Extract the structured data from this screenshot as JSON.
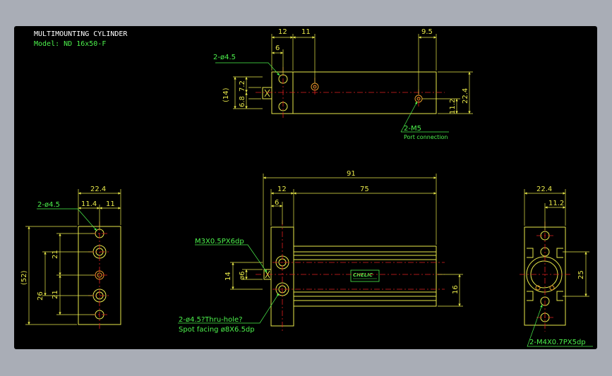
{
  "title": {
    "line1": "MULTIMOUNTING CYLINDER",
    "line2": "Model: ND 16x50-F"
  },
  "top_view": {
    "dim_12": "12",
    "dim_11": "11",
    "dim_9_5": "9.5",
    "dim_6": "6",
    "hole_label": "2-ø4.5",
    "dim_14": "(14)",
    "dim_7_2": "7.2",
    "dim_6_8": "6.8",
    "dim_11_2": "11.2",
    "dim_22_4": "22.4",
    "port_label": "2-M5",
    "port_desc": "Port connection"
  },
  "front_view": {
    "dim_91": "91",
    "dim_12": "12",
    "dim_75": "75",
    "dim_6": "6",
    "thread_label": "M3X0.5PX6dp",
    "dim_14": "14",
    "dim_phi6": "ø6",
    "dim_16": "16",
    "hole_label": "2-ø4.5?Thru-hole?",
    "spot_label": "Spot facing ø8X6.5dp",
    "brand": "CHELIC"
  },
  "left_view": {
    "dim_22_4": "22.4",
    "hole_label": "2-ø4.5",
    "dim_11_4": "11.4",
    "dim_11": "11",
    "dim_52": "(52)",
    "dim_21a": "21",
    "dim_21b": "21",
    "dim_26": "26"
  },
  "right_view": {
    "dim_22_4": "22.4",
    "dim_11_2": "11.2",
    "dim_25": "25",
    "thread_label": "2-M4X0.7PX5dp"
  },
  "colors": {
    "background": "#a9adb6",
    "canvas": "#000000",
    "outline": "#e9e94a",
    "centerline": "#e02020",
    "dimension": "#e9e94a",
    "text_green": "#4cf24c",
    "title_white": "#ffffff",
    "hole_orange": "#e59a2a"
  }
}
